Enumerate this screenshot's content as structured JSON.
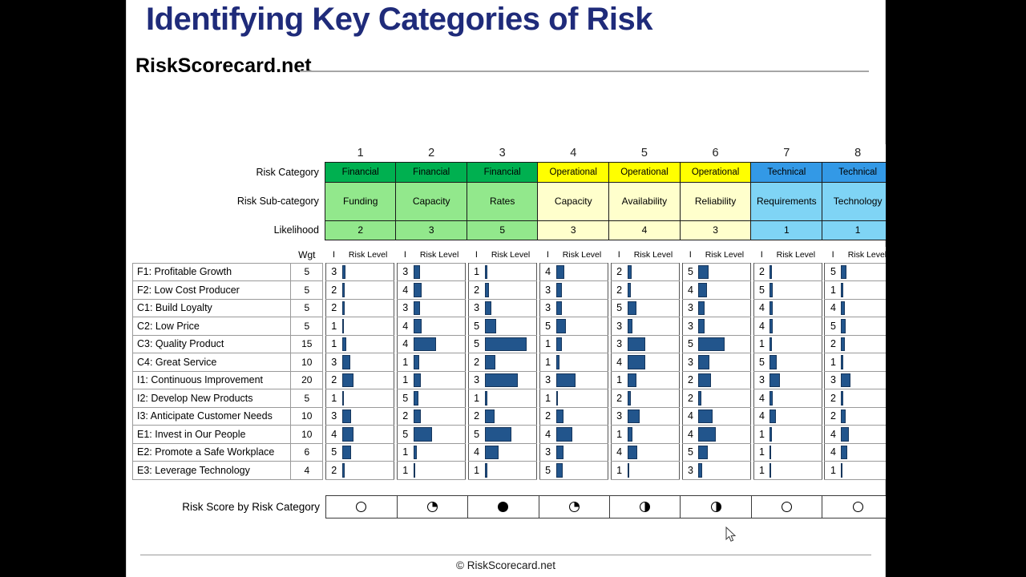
{
  "slide": {
    "title": "Identifying Key Categories of Risk",
    "brand": "RiskScorecard.net",
    "footer": "© RiskScorecard.net"
  },
  "row_labels": {
    "risk_category": "Risk Category",
    "risk_subcategory": "Risk Sub-category",
    "likelihood": "Likelihood",
    "score_row": "Risk Score by Risk Category",
    "wgt": "Wgt",
    "impact": "I",
    "risk_level": "Risk Level"
  },
  "colors": {
    "title": "#1f2b7a",
    "financial_header": "#00b050",
    "financial_body": "#92e88c",
    "operational_header": "#ffff00",
    "operational_body": "#ffffcc",
    "technical_header": "#3399e6",
    "technical_body": "#7fd4f5",
    "bar": "#22558c",
    "bar_border": "#16365c"
  },
  "columns": [
    {
      "number": "1",
      "category": "Financial",
      "subcategory": "Funding",
      "likelihood": "2",
      "theme": "financial",
      "score_ball": "empty"
    },
    {
      "number": "2",
      "category": "Financial",
      "subcategory": "Capacity",
      "likelihood": "3",
      "theme": "financial",
      "score_ball": "quarter"
    },
    {
      "number": "3",
      "category": "Financial",
      "subcategory": "Rates",
      "likelihood": "5",
      "theme": "financial",
      "score_ball": "full"
    },
    {
      "number": "4",
      "category": "Operational",
      "subcategory": "Capacity",
      "likelihood": "3",
      "theme": "operational",
      "score_ball": "quarter"
    },
    {
      "number": "5",
      "category": "Operational",
      "subcategory": "Availability",
      "likelihood": "4",
      "theme": "operational",
      "score_ball": "half"
    },
    {
      "number": "6",
      "category": "Operational",
      "subcategory": "Reliability",
      "likelihood": "3",
      "theme": "operational",
      "score_ball": "half"
    },
    {
      "number": "7",
      "category": "Technical",
      "subcategory": "Requirements",
      "likelihood": "1",
      "theme": "technical",
      "score_ball": "empty"
    },
    {
      "number": "8",
      "category": "Technical",
      "subcategory": "Technology",
      "likelihood": "1",
      "theme": "technical",
      "score_ball": "empty"
    }
  ],
  "objectives": [
    {
      "label": "F1: Profitable Growth",
      "wgt": "5",
      "impacts": [
        "3",
        "3",
        "1",
        "4",
        "2",
        "5",
        "2",
        "5"
      ],
      "bars": [
        4,
        8,
        3,
        10,
        5,
        13,
        3,
        7
      ]
    },
    {
      "label": "F2: Low Cost Producer",
      "wgt": "5",
      "impacts": [
        "2",
        "4",
        "2",
        "3",
        "2",
        "4",
        "5",
        "1"
      ],
      "bars": [
        3,
        10,
        5,
        7,
        4,
        11,
        4,
        3
      ]
    },
    {
      "label": "C1: Build Loyalty",
      "wgt": "5",
      "impacts": [
        "2",
        "3",
        "3",
        "3",
        "5",
        "3",
        "4",
        "4"
      ],
      "bars": [
        3,
        8,
        8,
        7,
        11,
        8,
        4,
        5
      ]
    },
    {
      "label": "C2: Low Price",
      "wgt": "5",
      "impacts": [
        "1",
        "4",
        "5",
        "5",
        "3",
        "3",
        "4",
        "5"
      ],
      "bars": [
        2,
        10,
        14,
        12,
        6,
        8,
        4,
        6
      ]
    },
    {
      "label": "C3: Quality Product",
      "wgt": "15",
      "impacts": [
        "1",
        "4",
        "5",
        "1",
        "3",
        "5",
        "1",
        "2"
      ],
      "bars": [
        5,
        28,
        52,
        7,
        22,
        33,
        3,
        5
      ]
    },
    {
      "label": "C4: Great Service",
      "wgt": "10",
      "impacts": [
        "3",
        "1",
        "2",
        "1",
        "4",
        "3",
        "5",
        "1"
      ],
      "bars": [
        10,
        7,
        13,
        4,
        22,
        14,
        9,
        3
      ]
    },
    {
      "label": "I1: Continuous Improvement",
      "wgt": "20",
      "impacts": [
        "2",
        "1",
        "3",
        "3",
        "1",
        "2",
        "3",
        "3"
      ],
      "bars": [
        14,
        9,
        41,
        24,
        11,
        16,
        13,
        12
      ]
    },
    {
      "label": "I2: Develop New Products",
      "wgt": "5",
      "impacts": [
        "1",
        "5",
        "1",
        "1",
        "2",
        "2",
        "4",
        "2"
      ],
      "bars": [
        2,
        6,
        3,
        2,
        4,
        4,
        4,
        3
      ]
    },
    {
      "label": "I3: Anticipate Customer Needs",
      "wgt": "10",
      "impacts": [
        "3",
        "2",
        "2",
        "2",
        "3",
        "4",
        "4",
        "2"
      ],
      "bars": [
        11,
        9,
        12,
        9,
        15,
        18,
        8,
        6
      ]
    },
    {
      "label": "E1: Invest in Our People",
      "wgt": "10",
      "impacts": [
        "4",
        "5",
        "5",
        "4",
        "1",
        "4",
        "1",
        "4"
      ],
      "bars": [
        14,
        23,
        33,
        20,
        6,
        22,
        3,
        10
      ]
    },
    {
      "label": "E2: Promote a Safe Workplace",
      "wgt": "6",
      "impacts": [
        "5",
        "1",
        "4",
        "3",
        "4",
        "5",
        "1",
        "4"
      ],
      "bars": [
        11,
        4,
        17,
        9,
        12,
        12,
        2,
        8
      ]
    },
    {
      "label": "E3: Leverage Technology",
      "wgt": "4",
      "impacts": [
        "2",
        "1",
        "1",
        "5",
        "1",
        "3",
        "1",
        "1"
      ],
      "bars": [
        3,
        2,
        3,
        8,
        2,
        5,
        1,
        2
      ]
    }
  ]
}
